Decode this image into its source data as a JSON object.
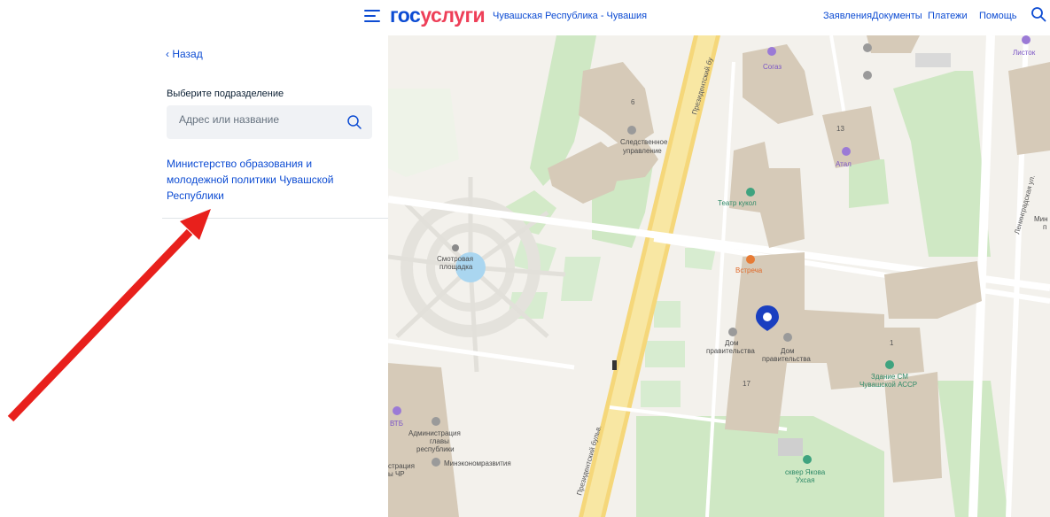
{
  "header": {
    "logo_part1": "гос",
    "logo_part2": "услуги",
    "region": "Чувашская Республика - Чувашия",
    "nav": [
      {
        "label": "Заявления"
      },
      {
        "label": "Документы"
      },
      {
        "label": "Платежи"
      },
      {
        "label": "Помощь"
      }
    ]
  },
  "panel": {
    "back_label": "‹ Назад",
    "section_label": "Выберите подразделение",
    "search_placeholder": "Адрес или название",
    "result_title": "Министерство образования и молодежной политики Чувашской Республики"
  },
  "map": {
    "labels": {
      "sogaz": "Согаз",
      "listok": "Листок",
      "sledstv1": "Следственное",
      "sledstv2": "управление",
      "atal": "Атал",
      "teatr": "Театр кукол",
      "smotr1": "Смотровая",
      "smotr2": "площадка",
      "vstrecha": "Встреча",
      "dom1a": "Дом",
      "dom1b": "правительства",
      "dom2a": "Дом",
      "dom2b": "правительства",
      "zdanie1": "Здание СМ",
      "zdanie2": "Чувашской АССР",
      "vtb": "ВТБ",
      "admin1": "Администрация",
      "admin2": "главы",
      "admin3": "республики",
      "admin_left1": "страция",
      "admin_left2": "ы ЧР",
      "minek": "Минэкономразвития",
      "skver1": "сквер Якова",
      "skver2": "Ухсая",
      "road_top": "Президентский бу",
      "road_bottom": "Президентский бульв.",
      "leningr": "Ленинградская ул.",
      "min_edge1": "Мин",
      "min_edge2": "п",
      "num_6": "6",
      "num_13": "13",
      "num_1": "1",
      "num_17": "17"
    }
  },
  "colors": {
    "brand_blue": "#0d4cd3",
    "brand_red": "#ee3f58",
    "arrow": "#e8201c",
    "marker": "#1a3fc0"
  }
}
